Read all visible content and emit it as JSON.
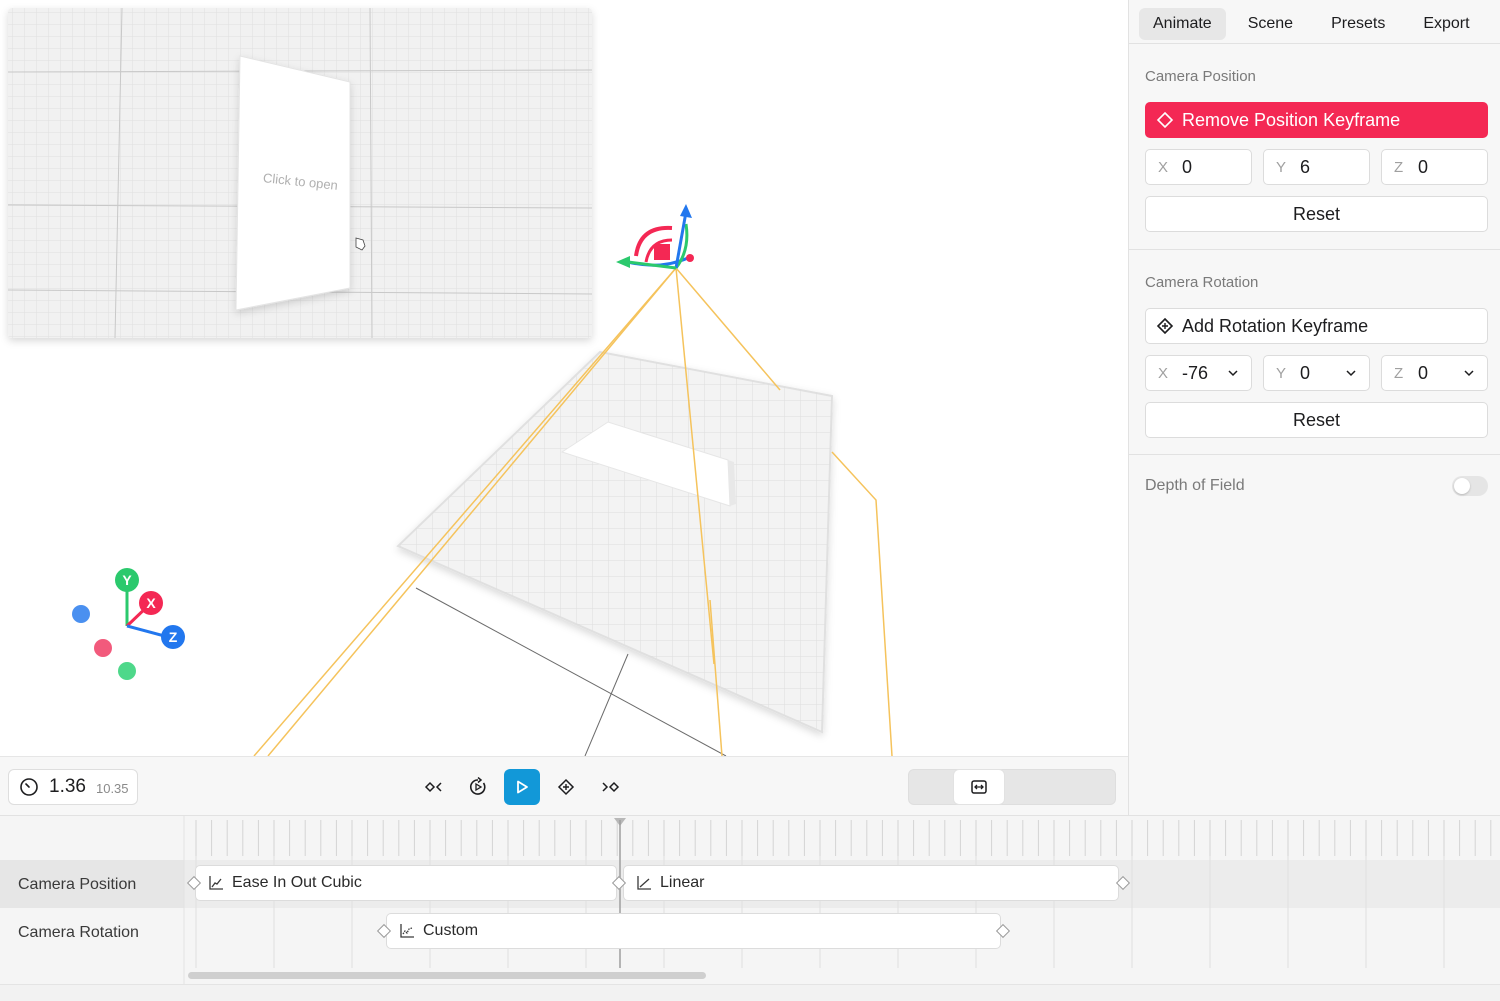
{
  "tabs": [
    {
      "label": "Animate",
      "active": true
    },
    {
      "label": "Scene",
      "active": false
    },
    {
      "label": "Presets",
      "active": false
    },
    {
      "label": "Export",
      "active": false
    }
  ],
  "camera_position": {
    "title": "Camera Position",
    "keyframe_button": "Remove Position Keyframe",
    "x_label": "X",
    "x": "0",
    "y_label": "Y",
    "y": "6",
    "z_label": "Z",
    "z": "0",
    "reset": "Reset"
  },
  "camera_rotation": {
    "title": "Camera Rotation",
    "keyframe_button": "Add Rotation Keyframe",
    "x_label": "X",
    "x": "-76",
    "y_label": "Y",
    "y": "0",
    "z_label": "Z",
    "z": "0",
    "reset": "Reset"
  },
  "depth_of_field": {
    "label": "Depth of Field",
    "enabled": false
  },
  "viewport": {
    "preview_card_text": "Click to open",
    "gizmo_axes": {
      "y": "Y",
      "x": "X",
      "z": "Z"
    }
  },
  "transport": {
    "current_time": "1.36",
    "total_time": "10.35"
  },
  "timeline": {
    "tracks": [
      {
        "label": "Camera Position",
        "clips": [
          {
            "label": "Ease In Out Cubic"
          },
          {
            "label": "Linear"
          }
        ]
      },
      {
        "label": "Camera Rotation",
        "clips": [
          {
            "label": "Custom"
          }
        ]
      }
    ]
  },
  "colors": {
    "accent_red": "#f42854",
    "play_blue": "#1298d8",
    "axis_x": "#f42854",
    "axis_y": "#2bc96d",
    "axis_z": "#2277ee",
    "frustum": "#f5c35c"
  }
}
